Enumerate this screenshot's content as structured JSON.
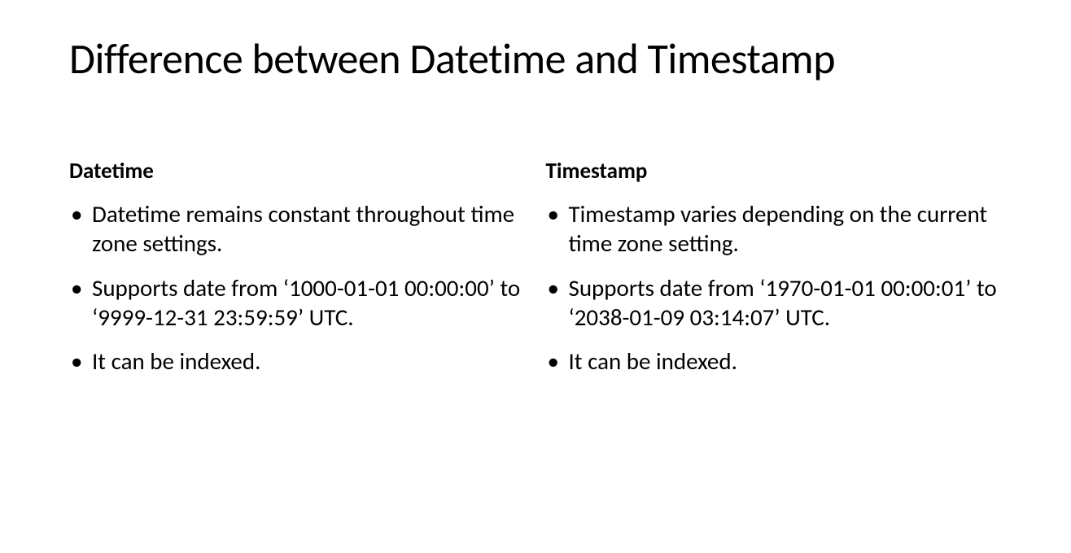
{
  "title": "Difference between Datetime and Timestamp",
  "left": {
    "heading": "Datetime",
    "bullets": [
      "Datetime remains constant throughout time zone settings.",
      "Supports date from ‘1000-01-01 00:00:00’ to ‘9999-12-31 23:59:59’ UTC.",
      "It can be indexed."
    ]
  },
  "right": {
    "heading": "Timestamp",
    "bullets": [
      "Timestamp varies depending on the current time zone setting.",
      "Supports date from ‘1970-01-01 00:00:01’ to ‘2038-01-09 03:14:07’ UTC.",
      "It can be indexed."
    ]
  }
}
